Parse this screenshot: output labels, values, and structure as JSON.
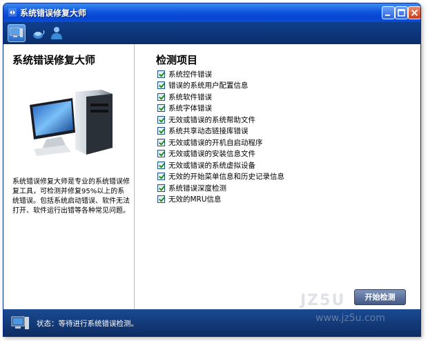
{
  "window": {
    "title": "系统错误修复大师"
  },
  "left_panel": {
    "title": "系统错误修复大师",
    "description": "系统错误修复大师是专业的系统错误修复工具，可检测并修复95%以上的系统错误。包括系统启动错误、软件无法打开、软件运行出错等各种常见问题。"
  },
  "right_panel": {
    "title": "检测项目",
    "items": [
      {
        "label": "系统控件错误",
        "checked": true
      },
      {
        "label": "错误的系统用户配置信息",
        "checked": true
      },
      {
        "label": "系统软件错误",
        "checked": true
      },
      {
        "label": "系统字体错误",
        "checked": true
      },
      {
        "label": "无效或错误的系统帮助文件",
        "checked": true
      },
      {
        "label": "系统共享动态链接库错误",
        "checked": true
      },
      {
        "label": "无效或错误的开机自启动程序",
        "checked": true
      },
      {
        "label": "无效或错误的安装信息文件",
        "checked": true
      },
      {
        "label": "无效或错误的系统虚拟设备",
        "checked": true
      },
      {
        "label": "无效的开始菜单信息和历史记录信息",
        "checked": true
      },
      {
        "label": "系统错误深度检测",
        "checked": true
      },
      {
        "label": "无效的MRU信息",
        "checked": true
      }
    ]
  },
  "start_button": {
    "label": "开始检测"
  },
  "status": {
    "text": "状态：等待进行系统错误检测。"
  },
  "watermark": {
    "text": "JZ5U",
    "url": "www.jz5u.com"
  },
  "icons": {
    "toolbar": [
      "computer-icon",
      "mouse-icon",
      "user-icon"
    ]
  },
  "colors": {
    "titlebar": "#0846d1",
    "toolbar": "#0b2e6a",
    "statusbar": "#0d2c62",
    "check": "#1d8a1d"
  }
}
